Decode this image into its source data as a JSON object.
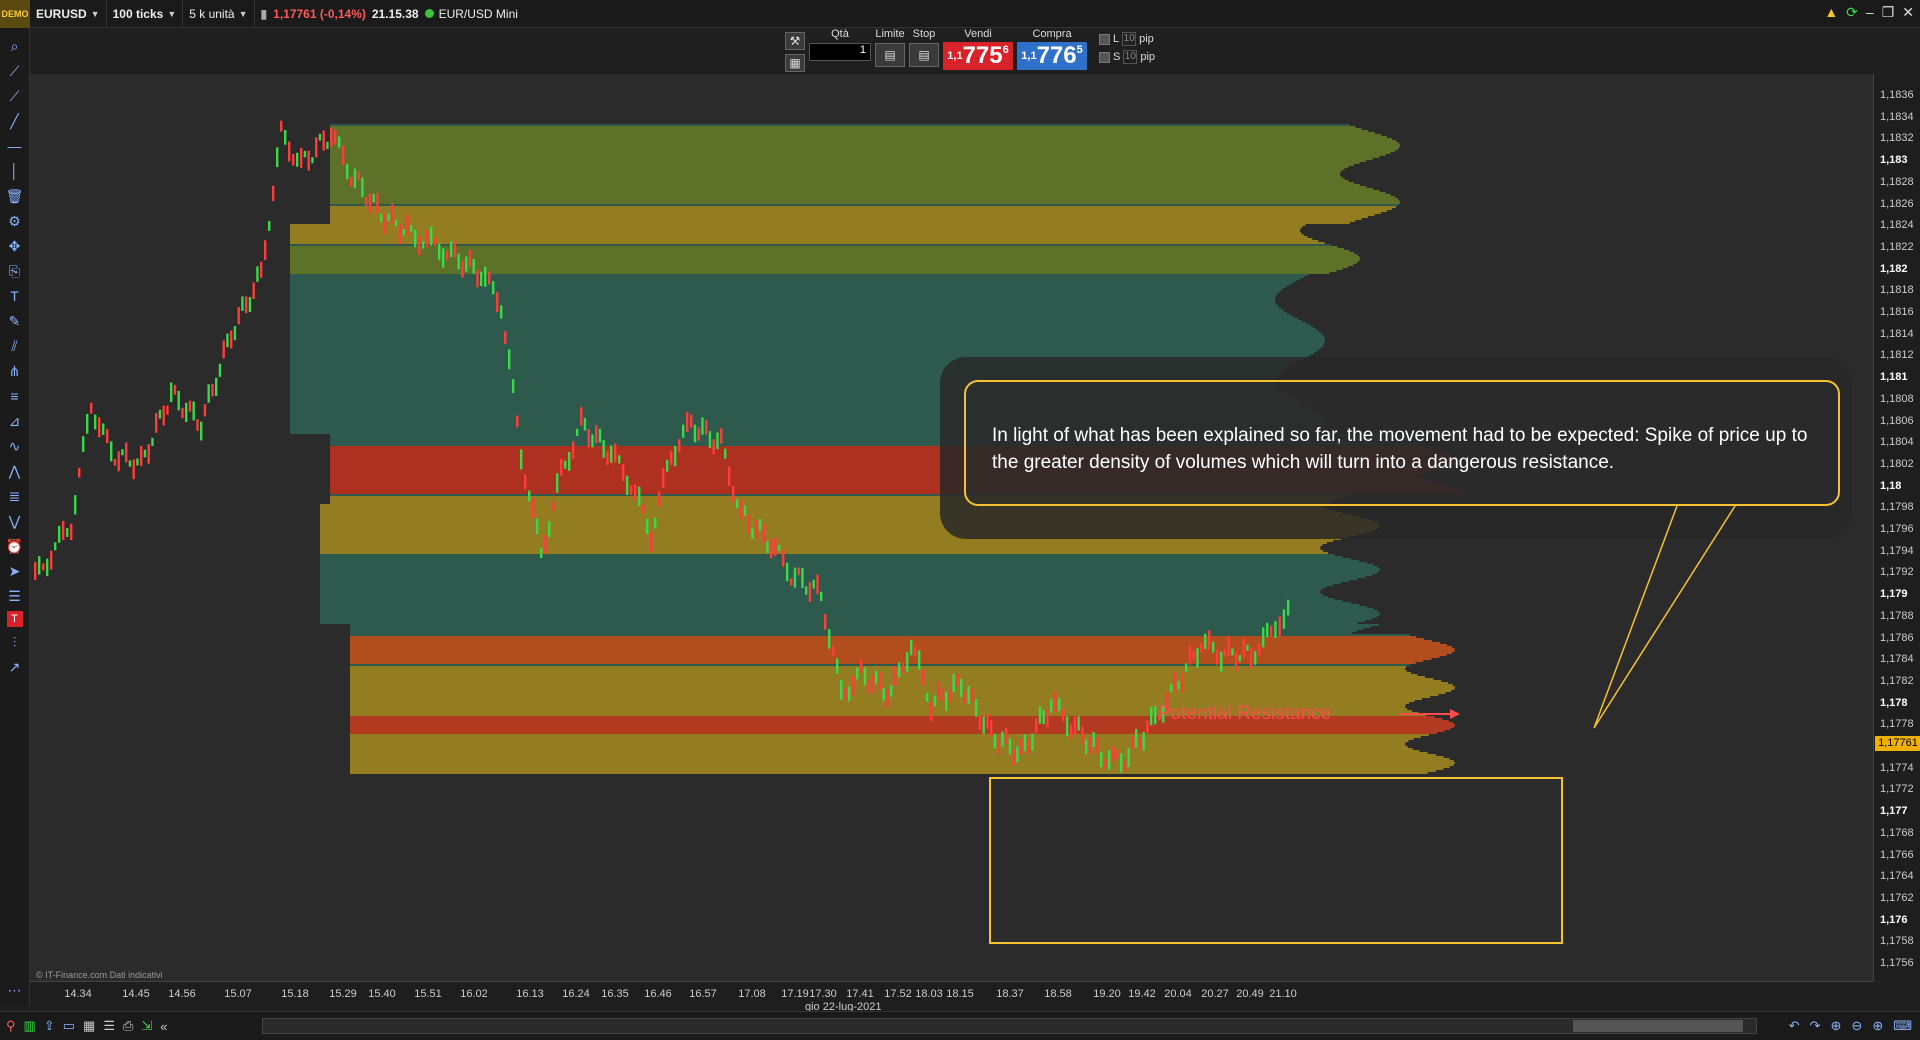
{
  "topbar": {
    "demo": "DEMO",
    "symbol": "EURUSD",
    "ticks": "100 ticks",
    "units": "5 k unità",
    "last": "1,17761 (-0,14%)",
    "time": "21.15.38",
    "instrument": "EUR/USD Mini"
  },
  "order": {
    "qty_label": "Qtà",
    "qty_value": "1",
    "limit_label": "Limite",
    "stop_label": "Stop",
    "sell_label": "Vendi",
    "buy_label": "Compra",
    "sell_small": "1,1",
    "sell_big": "775",
    "sell_sup": "6",
    "buy_small": "1,1",
    "buy_big": "776",
    "buy_sup": "5",
    "l_label": "L",
    "s_label": "S",
    "l_pips": "10",
    "s_pips": "10",
    "pip_label": "pip"
  },
  "yaxis": {
    "labels": [
      "1,1836",
      "1,1834",
      "1,1832",
      "1,183",
      "1,1828",
      "1,1826",
      "1,1824",
      "1,1822",
      "1,182",
      "1,1818",
      "1,1816",
      "1,1814",
      "1,1812",
      "1,181",
      "1,1808",
      "1,1806",
      "1,1804",
      "1,1802",
      "1,18",
      "1,1798",
      "1,1796",
      "1,1794",
      "1,1792",
      "1,179",
      "1,1788",
      "1,1786",
      "1,1784",
      "1,1782",
      "1,178",
      "1,1778",
      "1,1776",
      "1,1774",
      "1,1772",
      "1,177",
      "1,1768",
      "1,1766",
      "1,1764",
      "1,1762",
      "1,176",
      "1,1758",
      "1,1756"
    ],
    "current": "1,17761"
  },
  "xaxis": {
    "labels": [
      "14.34",
      "14.45",
      "14.56",
      "15.07",
      "15.18",
      "15.29",
      "15.40",
      "15.51",
      "16.02",
      "16.13",
      "16.24",
      "16.35",
      "16.46",
      "16.57",
      "17.08",
      "17.19",
      "17.30",
      "17.41",
      "17.52",
      "18.03",
      "18.15",
      "18.37",
      "18.58",
      "19.20",
      "19.42",
      "20.04",
      "20.27",
      "20.49",
      "21.10"
    ],
    "date": "gio 22-lug-2021"
  },
  "annotation": {
    "text": "In light of what has been explained so far, the movement had to be expected: Spike of price up to the greater density of volumes which will turn into a dangerous resistance.",
    "resistance": "Potential Resistance"
  },
  "footer": "© IT-Finance.com Dati indicativi",
  "colors": {
    "up": "#39d94a",
    "down": "#ff3b3b",
    "accent": "#f4c233",
    "sell": "#d8222a",
    "buy": "#2f71c8"
  }
}
